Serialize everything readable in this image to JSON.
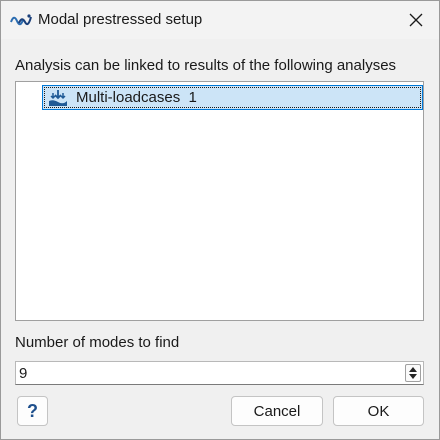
{
  "window": {
    "title": "Modal prestressed setup",
    "app_icon": "waveform-logo-icon",
    "close_icon": "close-icon"
  },
  "analyses": {
    "label": "Analysis can be linked to results of the following analyses",
    "items": [
      {
        "icon": "loadcase-icon",
        "label": "Multi-loadcases  1",
        "selected": true
      }
    ]
  },
  "modes": {
    "label": "Number of modes to find",
    "value": "9"
  },
  "buttons": {
    "help": "?",
    "cancel": "Cancel",
    "ok": "OK"
  },
  "colors": {
    "selection_fill": "#cce4f7",
    "selection_border": "#0078d7",
    "accent": "#1e4f8c"
  }
}
